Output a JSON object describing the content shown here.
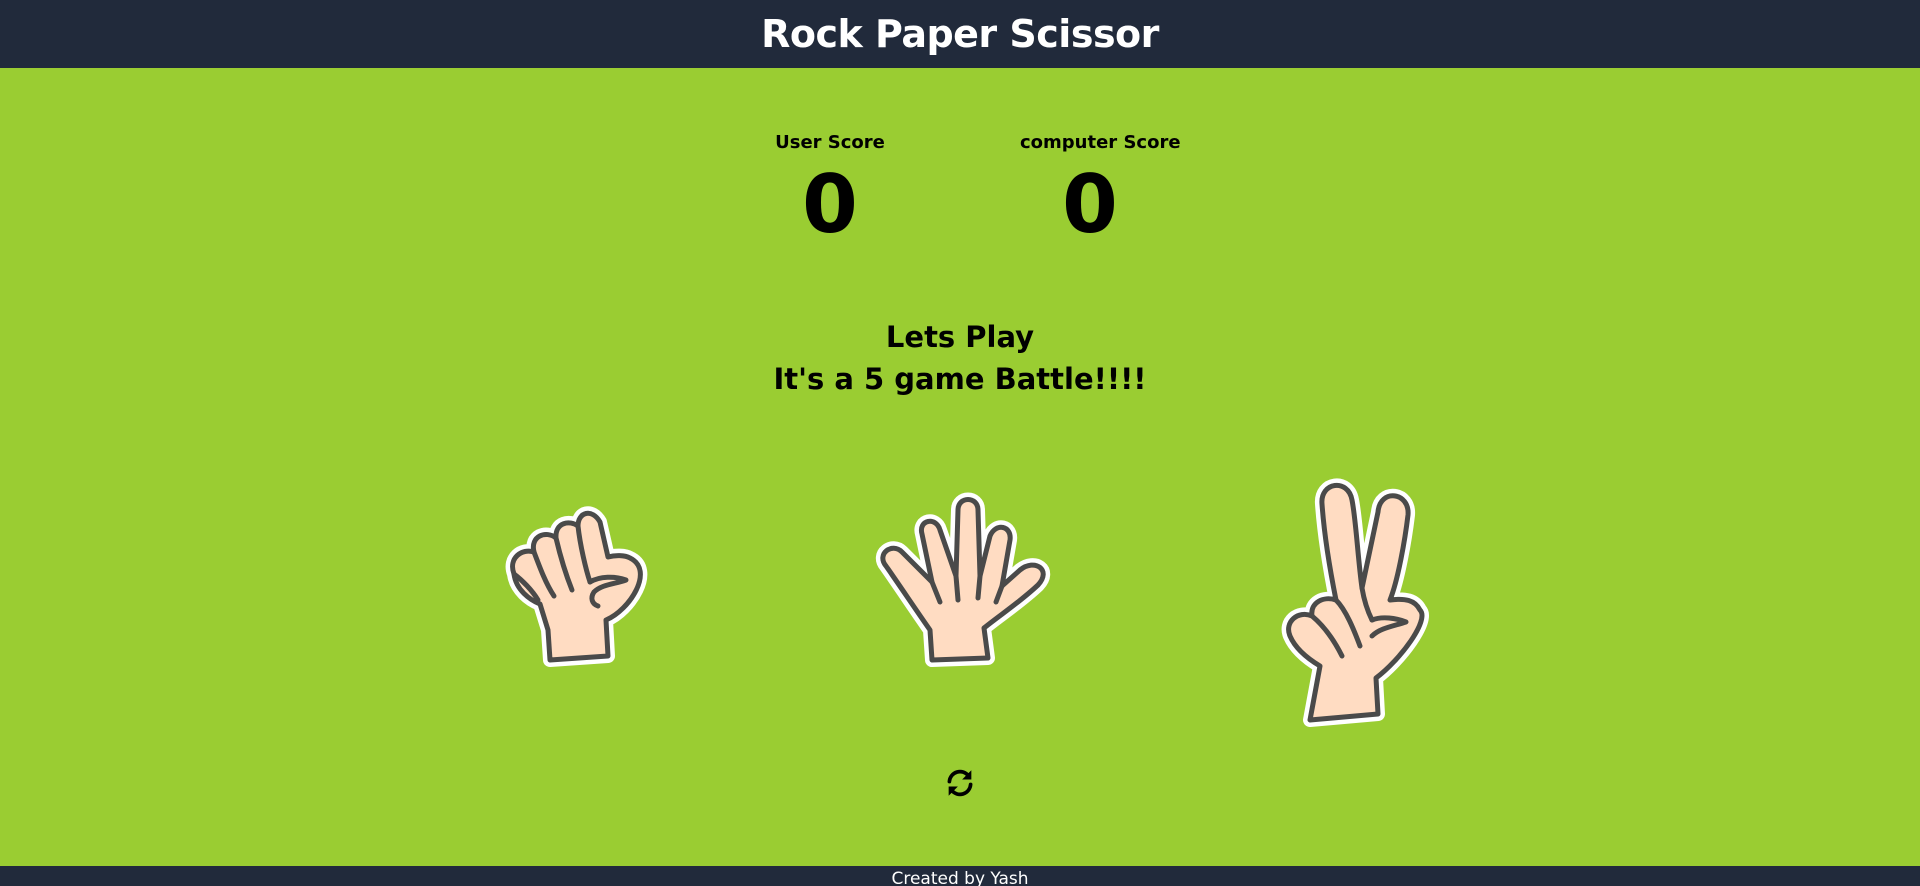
{
  "header": {
    "title": "Rock Paper Scissor"
  },
  "scoreboard": {
    "user_label": "User Score",
    "user_score": "0",
    "computer_label": "computer Score",
    "computer_score": "0"
  },
  "message": {
    "line1": "Lets Play",
    "line2": "It's a 5 game Battle!!!!"
  },
  "choices": [
    {
      "id": "rock",
      "icon": "rock-hand-icon"
    },
    {
      "id": "paper",
      "icon": "paper-hand-icon"
    },
    {
      "id": "scissors",
      "icon": "scissors-hand-icon"
    }
  ],
  "controls": {
    "reset_icon": "refresh-icon"
  },
  "footer": {
    "text": "Created by Yash"
  },
  "colors": {
    "background": "#9acd32",
    "bars": "#212a3b",
    "skin": "#ffdcc2",
    "outline": "#4a4a4a"
  }
}
